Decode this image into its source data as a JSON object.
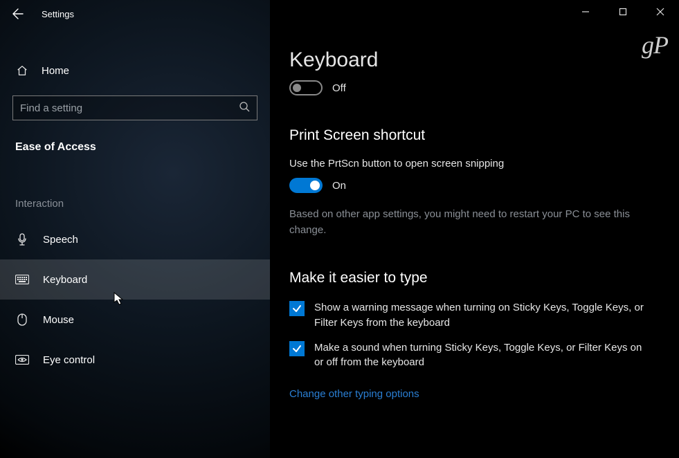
{
  "app_title": "Settings",
  "home_label": "Home",
  "search_placeholder": "Find a setting",
  "category_title": "Ease of Access",
  "group_label": "Interaction",
  "nav_items": {
    "speech": "Speech",
    "keyboard": "Keyboard",
    "mouse": "Mouse",
    "eye_control": "Eye control"
  },
  "page_title": "Keyboard",
  "toggle1_label": "Off",
  "section_print_title": "Print Screen shortcut",
  "print_desc": "Use the PrtScn button to open screen snipping",
  "toggle2_label": "On",
  "print_hint": "Based on other app settings, you might need to restart your PC to see this change.",
  "section_type_title": "Make it easier to type",
  "check1_label": "Show a warning message when turning on Sticky Keys, Toggle Keys, or Filter Keys from the keyboard",
  "check2_label": "Make a sound when turning Sticky Keys, Toggle Keys, or Filter Keys on or off from the keyboard",
  "link_label": "Change other typing options",
  "watermark": "gP",
  "colors": {
    "accent": "#0078d4",
    "link": "#2a7fd4"
  }
}
